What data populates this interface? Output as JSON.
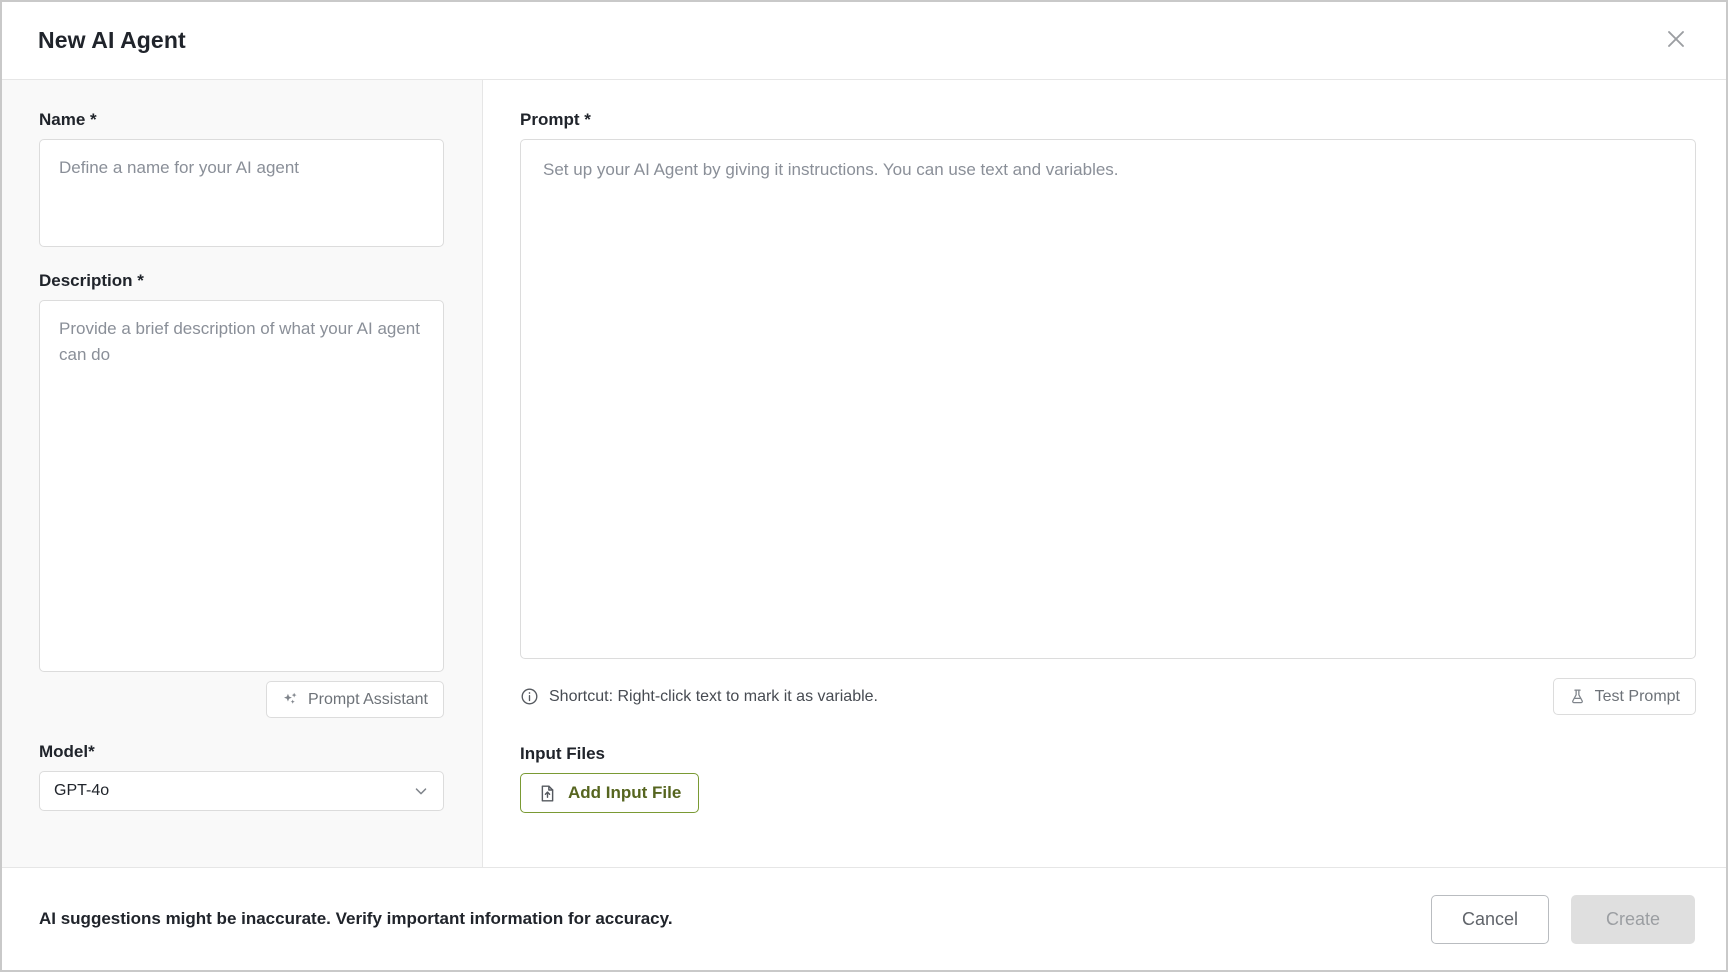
{
  "dialog": {
    "title": "New AI Agent",
    "close_icon": "close-icon"
  },
  "left_panel": {
    "name": {
      "label": "Name *",
      "placeholder": "Define a name for your AI agent",
      "value": ""
    },
    "description": {
      "label": "Description *",
      "placeholder": "Provide a brief description of what your AI agent can do",
      "value": ""
    },
    "prompt_assistant": {
      "label": "Prompt Assistant",
      "icon": "sparkle-icon"
    },
    "model": {
      "label": "Model*",
      "selected": "GPT-4o",
      "chevron_icon": "chevron-down-icon"
    }
  },
  "right_panel": {
    "prompt": {
      "label": "Prompt *",
      "placeholder": "Set up your AI Agent by giving it instructions. You can use text and variables.",
      "value": ""
    },
    "hint": {
      "icon": "info-icon",
      "text": "Shortcut: Right-click text to mark it as variable."
    },
    "test_prompt": {
      "label": "Test Prompt",
      "icon": "flask-icon"
    },
    "input_files": {
      "label": "Input Files",
      "add_button_label": "Add Input File",
      "add_button_icon": "file-upload-icon"
    }
  },
  "footer": {
    "disclaimer": "AI suggestions might be inaccurate. Verify important information for accuracy.",
    "cancel_label": "Cancel",
    "create_label": "Create"
  },
  "colors": {
    "accent_green": "#7a9a34",
    "green_text": "#56651f",
    "panel_bg": "#f9f9f9",
    "border": "#dcdcdc",
    "text_primary": "#20242b",
    "text_muted": "#8a8f98",
    "disabled_bg": "#dfdfdf"
  }
}
